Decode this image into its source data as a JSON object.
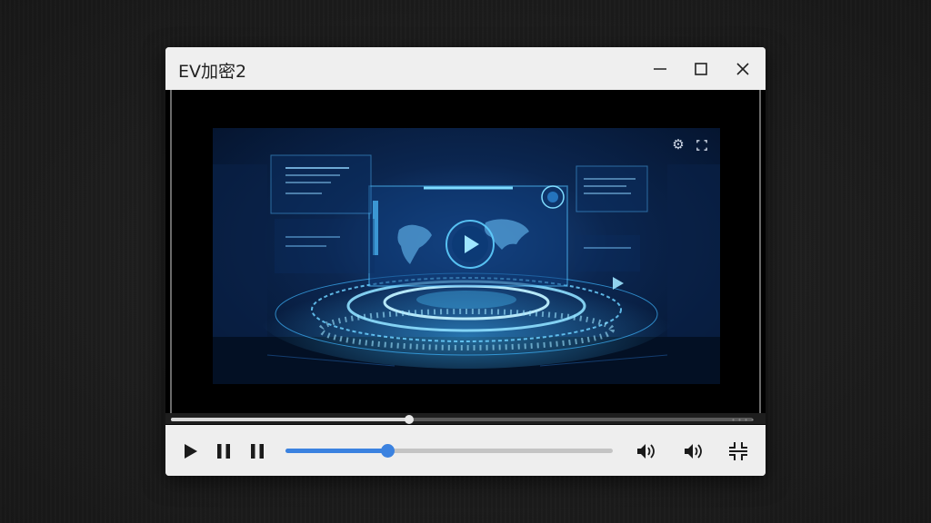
{
  "window": {
    "title": "EV加密2"
  },
  "titlebar_buttons": {
    "minimize_icon": "minimize-icon",
    "maximize_icon": "maximize-icon",
    "close_icon": "close-icon"
  },
  "video_overlay": {
    "settings_icon": "gear-icon",
    "fullscreen_icon": "expand-icon"
  },
  "seek_bar": {
    "progress": 0.41
  },
  "controls": {
    "play_icon": "play-icon",
    "pause_icon_1": "pause-icon",
    "pause_icon_2": "pause-icon",
    "slider_progress": 0.31,
    "volume_icon_1": "volume-icon",
    "volume_icon_2": "volume-icon",
    "fullscreen_icon": "fullscreen-icon"
  },
  "colors": {
    "accent": "#3b82e0",
    "video_glow": "#3fb6ff"
  }
}
